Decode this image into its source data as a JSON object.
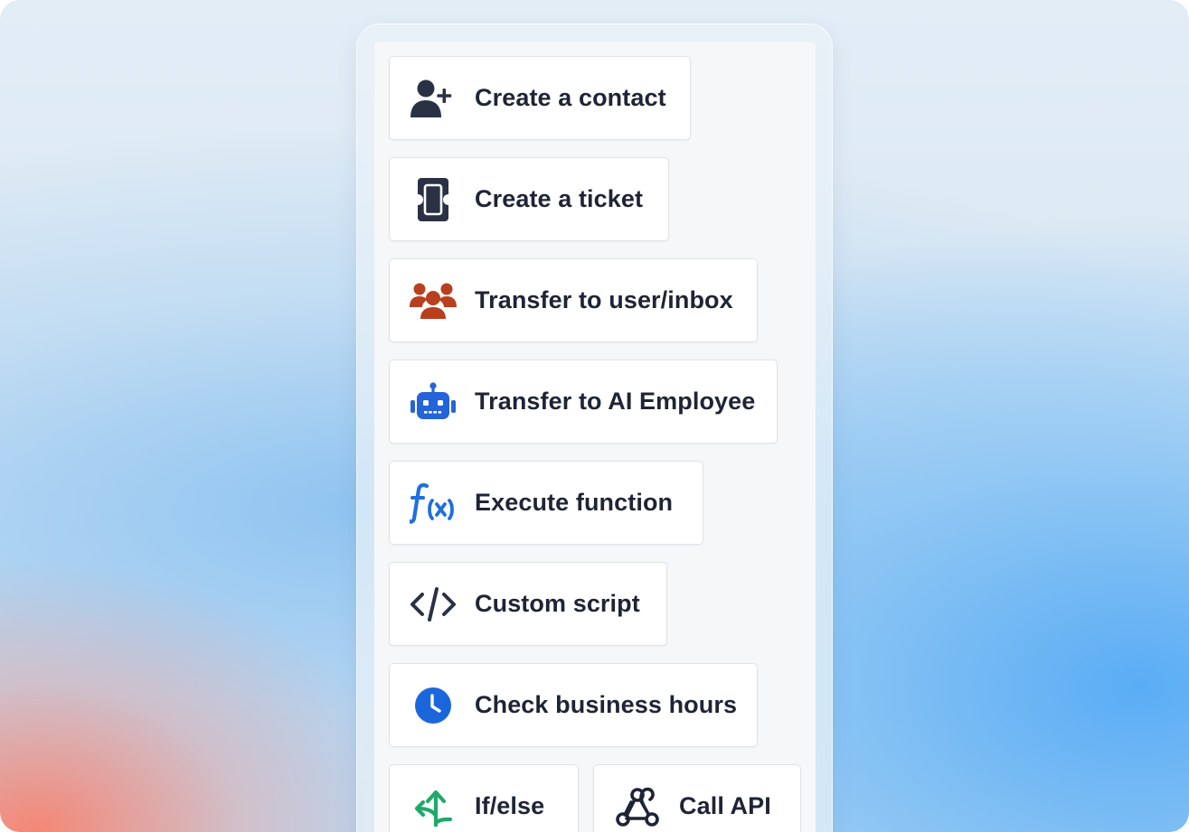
{
  "actions": [
    {
      "id": "create-contact",
      "label": "Create a contact",
      "icon": "add-user-icon",
      "color": "#2b3145"
    },
    {
      "id": "create-ticket",
      "label": "Create a ticket",
      "icon": "ticket-icon",
      "color": "#2b3145"
    },
    {
      "id": "transfer-user",
      "label": "Transfer to user/inbox",
      "icon": "users-group-icon",
      "color": "#b8401e"
    },
    {
      "id": "transfer-ai",
      "label": "Transfer to AI Employee",
      "icon": "robot-icon",
      "color": "#2563d9"
    },
    {
      "id": "execute-function",
      "label": "Execute function",
      "icon": "function-icon",
      "color": "#1f6fe0"
    },
    {
      "id": "custom-script",
      "label": "Custom script",
      "icon": "code-icon",
      "color": "#2b3145"
    },
    {
      "id": "check-hours",
      "label": "Check business hours",
      "icon": "clock-icon",
      "color": "#1c66dc"
    },
    {
      "id": "if-else",
      "label": "If/else",
      "icon": "branch-icon",
      "color": "#1faa6a"
    },
    {
      "id": "call-api",
      "label": "Call API",
      "icon": "webhook-icon",
      "color": "#1f2435"
    }
  ]
}
